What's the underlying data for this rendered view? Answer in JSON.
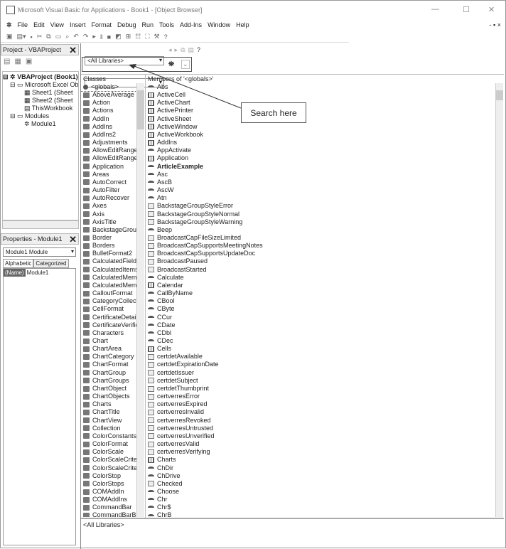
{
  "window": {
    "title": "Microsoft Visual Basic for Applications - Book1 - [Object Browser]",
    "minimize": "—",
    "maximize": "☐",
    "close": "✕"
  },
  "menu": [
    "File",
    "Edit",
    "View",
    "Insert",
    "Format",
    "Debug",
    "Run",
    "Tools",
    "Add-Ins",
    "Window",
    "Help"
  ],
  "project": {
    "title": "Project - VBAProject",
    "tree": [
      "VBAProject (Book1)",
      "Microsoft Excel Ob",
      "Sheet1 (Sheet",
      "Sheet2 (Sheet",
      "ThisWorkbook",
      "Modules",
      "Module1"
    ]
  },
  "properties": {
    "title": "Properties - Module1",
    "object": "Module1 Module",
    "tabs": [
      "Alphabetic",
      "Categorized"
    ],
    "prop_name": "(Name)",
    "prop_value": "Module1"
  },
  "browser": {
    "library": "<All Libraries>",
    "search_value": "",
    "classes_header": "Classes",
    "members_header": "Members of '<globals>'",
    "details": "<All Libraries>",
    "classes": [
      "<globals>",
      "AboveAverage",
      "Action",
      "Actions",
      "AddIn",
      "AddIns",
      "AddIns2",
      "Adjustments",
      "AllowEditRange",
      "AllowEditRange",
      "Application",
      "Areas",
      "AutoCorrect",
      "AutoFilter",
      "AutoRecover",
      "Axes",
      "Axis",
      "AxisTitle",
      "BackstageGrou",
      "Border",
      "Borders",
      "BulletFormat2",
      "CalculatedField",
      "CalculatedItems",
      "CalculatedMemb",
      "CalculatedMemb",
      "CalloutFormat",
      "CategoryCollect",
      "CellFormat",
      "CertificateDetail",
      "CertificateVerific",
      "Characters",
      "Chart",
      "ChartArea",
      "ChartCategory",
      "ChartFormat",
      "ChartGroup",
      "ChartGroups",
      "ChartObject",
      "ChartObjects",
      "Charts",
      "ChartTitle",
      "ChartView",
      "Collection",
      "ColorConstants",
      "ColorFormat",
      "ColorScale",
      "ColorScaleCrite",
      "ColorScaleCrite",
      "ColorStop",
      "ColorStops",
      "COMAddIn",
      "COMAddIns",
      "CommandBar",
      "CommandBarB"
    ],
    "members": [
      [
        "Abs",
        "func"
      ],
      [
        "ActiveCell",
        "prop"
      ],
      [
        "ActiveChart",
        "prop"
      ],
      [
        "ActivePrinter",
        "prop"
      ],
      [
        "ActiveSheet",
        "prop"
      ],
      [
        "ActiveWindow",
        "prop"
      ],
      [
        "ActiveWorkbook",
        "prop"
      ],
      [
        "AddIns",
        "prop"
      ],
      [
        "AppActivate",
        "func"
      ],
      [
        "Application",
        "prop"
      ],
      [
        "ArticleExample",
        "func"
      ],
      [
        "Asc",
        "func"
      ],
      [
        "AscB",
        "func"
      ],
      [
        "AscW",
        "func"
      ],
      [
        "Atn",
        "func"
      ],
      [
        "BackstageGroupStyleError",
        "const"
      ],
      [
        "BackstageGroupStyleNormal",
        "const"
      ],
      [
        "BackstageGroupStyleWarning",
        "const"
      ],
      [
        "Beep",
        "func"
      ],
      [
        "BroadcastCapFileSizeLimited",
        "const"
      ],
      [
        "BroadcastCapSupportsMeetingNotes",
        "const"
      ],
      [
        "BroadcastCapSupportsUpdateDoc",
        "const"
      ],
      [
        "BroadcastPaused",
        "const"
      ],
      [
        "BroadcastStarted",
        "const"
      ],
      [
        "Calculate",
        "func"
      ],
      [
        "Calendar",
        "prop"
      ],
      [
        "CallByName",
        "func"
      ],
      [
        "CBool",
        "func"
      ],
      [
        "CByte",
        "func"
      ],
      [
        "CCur",
        "func"
      ],
      [
        "CDate",
        "func"
      ],
      [
        "CDbl",
        "func"
      ],
      [
        "CDec",
        "func"
      ],
      [
        "Cells",
        "prop"
      ],
      [
        "certdetAvailable",
        "const"
      ],
      [
        "certdetExpirationDate",
        "const"
      ],
      [
        "certdetIssuer",
        "const"
      ],
      [
        "certdetSubject",
        "const"
      ],
      [
        "certdetThumbprint",
        "const"
      ],
      [
        "certverresError",
        "const"
      ],
      [
        "certverresExpired",
        "const"
      ],
      [
        "certverresInvalid",
        "const"
      ],
      [
        "certverresRevoked",
        "const"
      ],
      [
        "certverresUntrusted",
        "const"
      ],
      [
        "certverresUnverified",
        "const"
      ],
      [
        "certverresValid",
        "const"
      ],
      [
        "certverresVerifying",
        "const"
      ],
      [
        "Charts",
        "prop"
      ],
      [
        "ChDir",
        "func"
      ],
      [
        "ChDrive",
        "func"
      ],
      [
        "Checked",
        "const"
      ],
      [
        "Choose",
        "func"
      ],
      [
        "Chr",
        "func"
      ],
      [
        "Chr$",
        "func"
      ],
      [
        "ChrB",
        "func"
      ]
    ]
  },
  "callout": {
    "text": "Search here"
  }
}
